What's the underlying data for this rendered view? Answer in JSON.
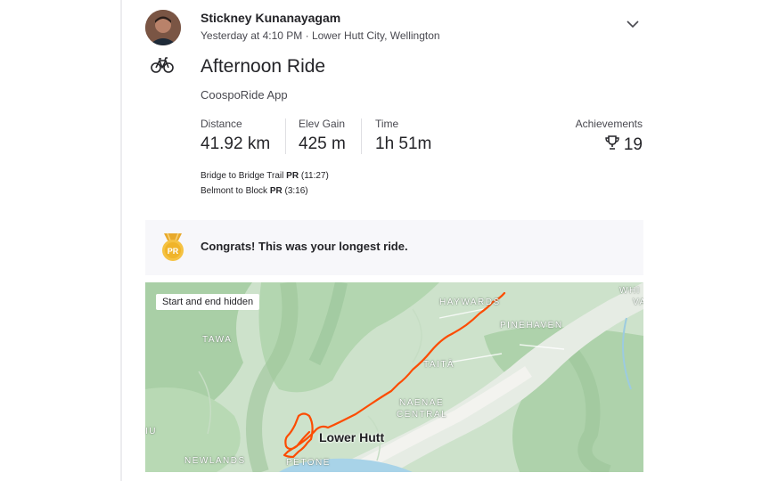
{
  "athlete": {
    "name": "Stickney Kunanayagam",
    "meta": "Yesterday at 4:10 PM · Lower Hutt City, Wellington"
  },
  "activity": {
    "sport_icon": "bike-icon",
    "title": "Afternoon Ride",
    "device": "CoospoRide App"
  },
  "stats": {
    "distance_label": "Distance",
    "distance_value": "41.92 km",
    "elev_label": "Elev Gain",
    "elev_value": "425 m",
    "time_label": "Time",
    "time_value": "1h 51m",
    "achievements_label": "Achievements",
    "achievements_value": "19",
    "achievements_icon": "trophy-icon"
  },
  "segments": [
    {
      "name": "Bridge to Bridge Trail",
      "badge": "PR",
      "time": "(11:27)"
    },
    {
      "name": "Belmont to Block",
      "badge": "PR",
      "time": "(3:16)"
    }
  ],
  "banner": {
    "icon": "pr-medal-icon",
    "medal_text": "PR",
    "message": "Congrats! This was your longest ride."
  },
  "map": {
    "badge": "Start and end hidden",
    "route_color": "#fc4c02",
    "places": {
      "haywards": "HAYWARDS",
      "whi": "WHI",
      "va": "VA",
      "pinehaven": "PINEHAVEN",
      "tawa": "TAWA",
      "taita": "TAITĀ",
      "naenae": "NAENAE",
      "central": "CENTRAL",
      "iu": "IU",
      "lower_hutt": "Lower Hutt",
      "newlands": "NEWLANDS",
      "petone": "PETONE"
    }
  },
  "colors": {
    "accent": "#fc4c02",
    "medal": "#f5c242"
  }
}
